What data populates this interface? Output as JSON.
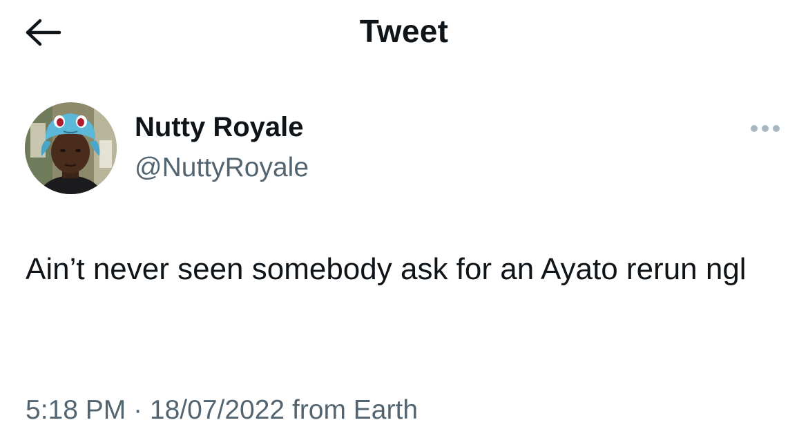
{
  "header": {
    "back_icon": "arrow-left-icon",
    "title": "Tweet"
  },
  "author": {
    "display_name": "Nutty Royale",
    "handle": "@NuttyRoyale",
    "avatar": "profile-photo"
  },
  "more_icon": "more-horizontal-icon",
  "tweet": {
    "text": "Ain’t never seen somebody ask for an Ayato rerun ngl"
  },
  "meta": {
    "time": "5:18 PM",
    "separator": " · ",
    "date": "18/07/2022",
    "source": " from Earth"
  },
  "colors": {
    "text_primary": "#0f1419",
    "text_secondary": "#536471",
    "icon_muted": "#aab8c2"
  }
}
